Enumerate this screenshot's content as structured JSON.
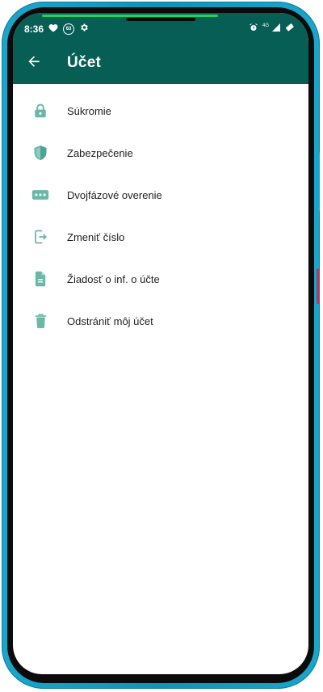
{
  "status_bar": {
    "time": "8:36",
    "battery_badge": "63",
    "network_label": "4G",
    "progress_fraction": 0.65
  },
  "app_bar": {
    "title": "Účet",
    "back_icon": "arrow-left-icon"
  },
  "menu": {
    "items": [
      {
        "label": "Súkromie",
        "icon": "lock-icon"
      },
      {
        "label": "Zabezpečenie",
        "icon": "shield-icon"
      },
      {
        "label": "Dvojfázové overenie",
        "icon": "password-dots-icon"
      },
      {
        "label": "Zmeniť číslo",
        "icon": "change-number-icon"
      },
      {
        "label": "Žiadosť o inf. o účte",
        "icon": "document-icon"
      },
      {
        "label": "Odstrániť môj účet",
        "icon": "trash-icon"
      }
    ]
  },
  "colors": {
    "header": "#075e54",
    "icon": "#6bb8a8",
    "text": "#1f1f1f",
    "frame": "#1aa6c9"
  }
}
